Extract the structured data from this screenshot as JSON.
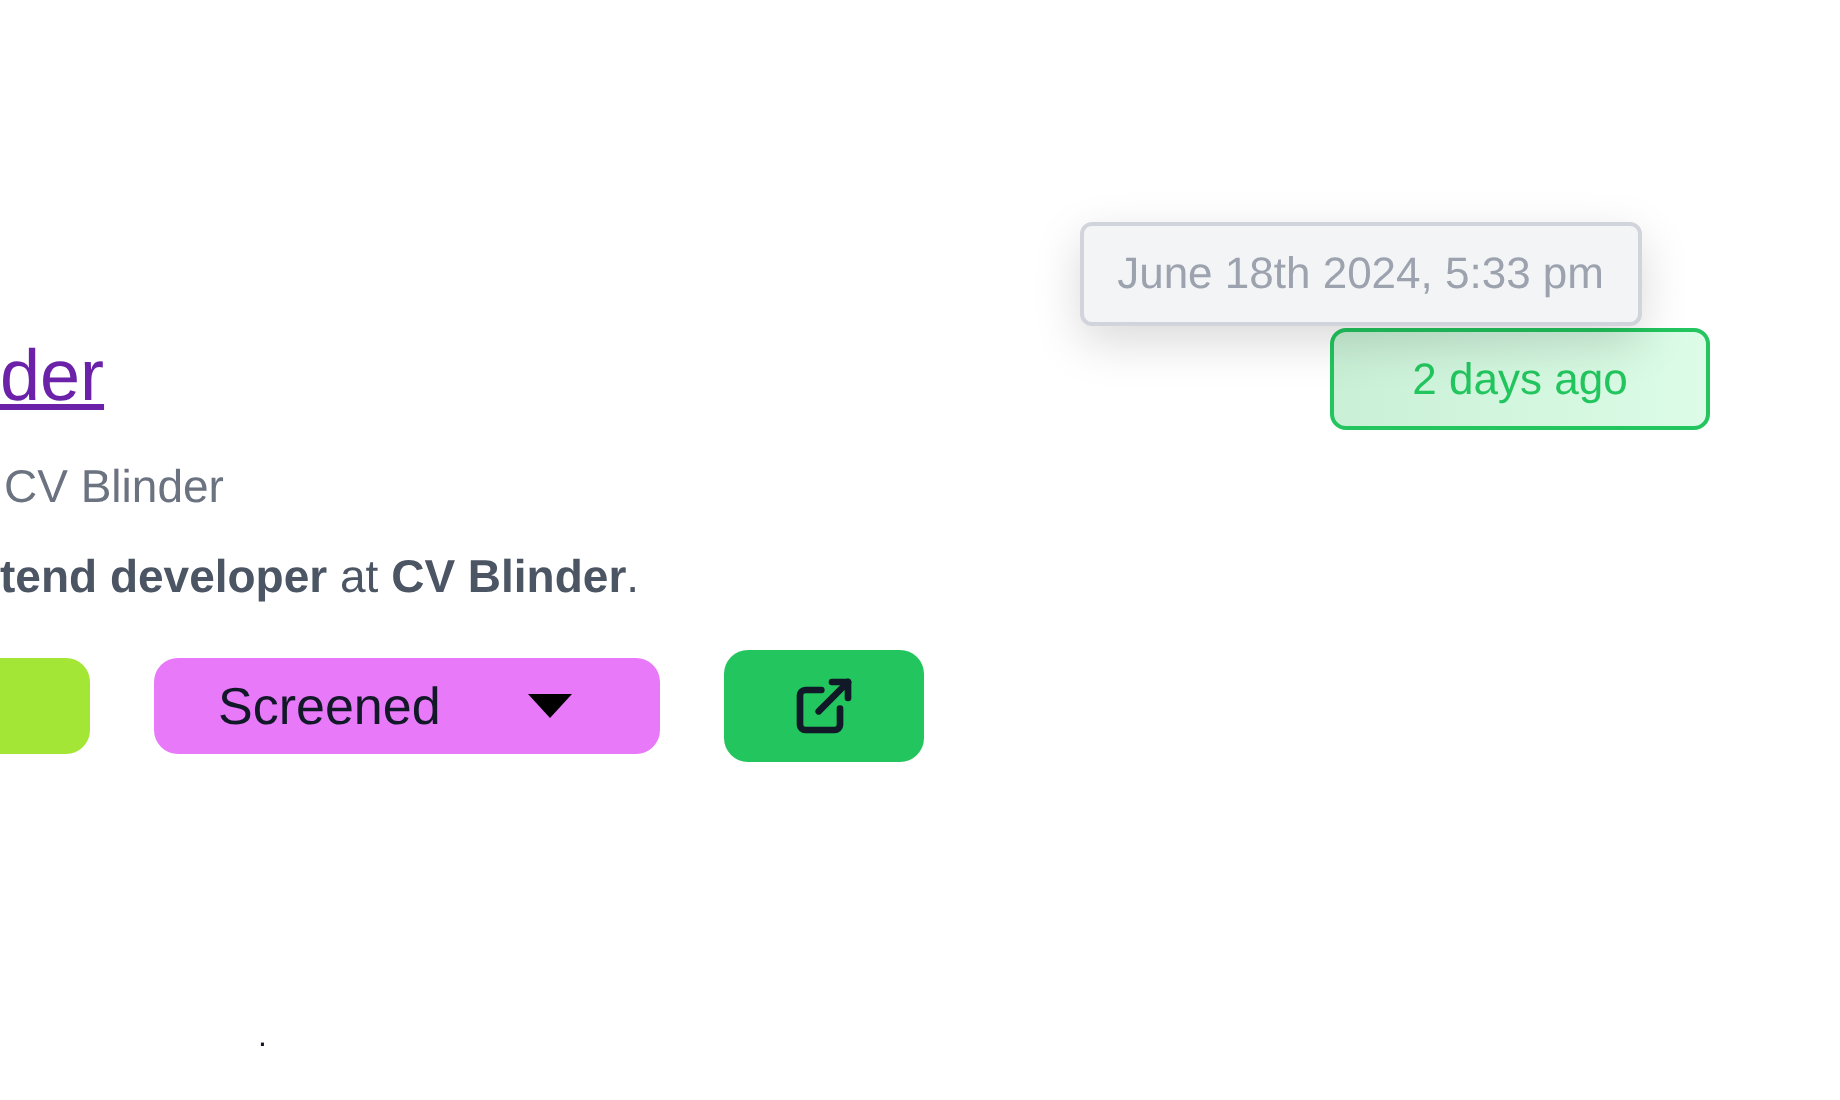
{
  "title_link": "der",
  "subtitle": "CV Blinder",
  "description": "**tend developer** at **CV Blinder**.",
  "status_select": {
    "value": "Screened"
  },
  "tooltip": "June 18th 2024, 5:33 pm",
  "age_badge": "2 days ago",
  "footer_mark": "."
}
